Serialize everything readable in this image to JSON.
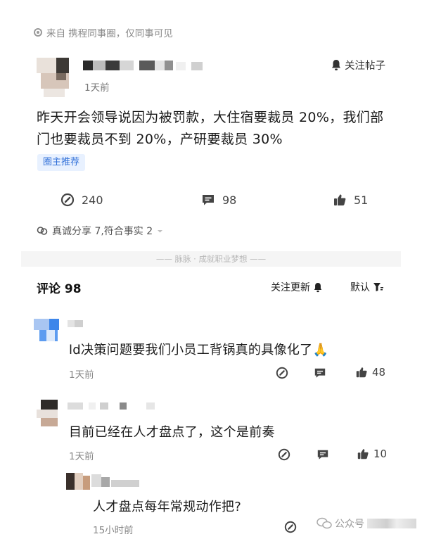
{
  "source_line": "来自 携程同事圈，仅同事可见",
  "post": {
    "follow_label": "关注帖子",
    "time": "1天前",
    "text": "昨天开会领导说因为被罚款，大住宿要裁员 20%，我们部门也要裁员不到 20%，产研要裁员 30%",
    "tag": "圈主推荐",
    "stats": {
      "comments": "240",
      "messages": "98",
      "likes": "51"
    },
    "truth_line": "真诚分享 7,符合事实 2"
  },
  "divider_text": "—— 脉脉 · 成就职业梦想 ——",
  "comments_header": {
    "title": "评论 98",
    "sort_follow": "关注更新",
    "sort_default": "默认"
  },
  "comments": [
    {
      "text": "ld决策问题要我们小员工背锅真的具像化了",
      "emoji": "🙏",
      "time": "1天前",
      "likes": "48"
    },
    {
      "text": "目前已经在人才盘点了，这个是前奏",
      "time": "1天前",
      "likes": "10"
    }
  ],
  "reply": {
    "text": "人才盘点每年常规动作把?",
    "time": "15小时前"
  },
  "watermark": "公众号"
}
